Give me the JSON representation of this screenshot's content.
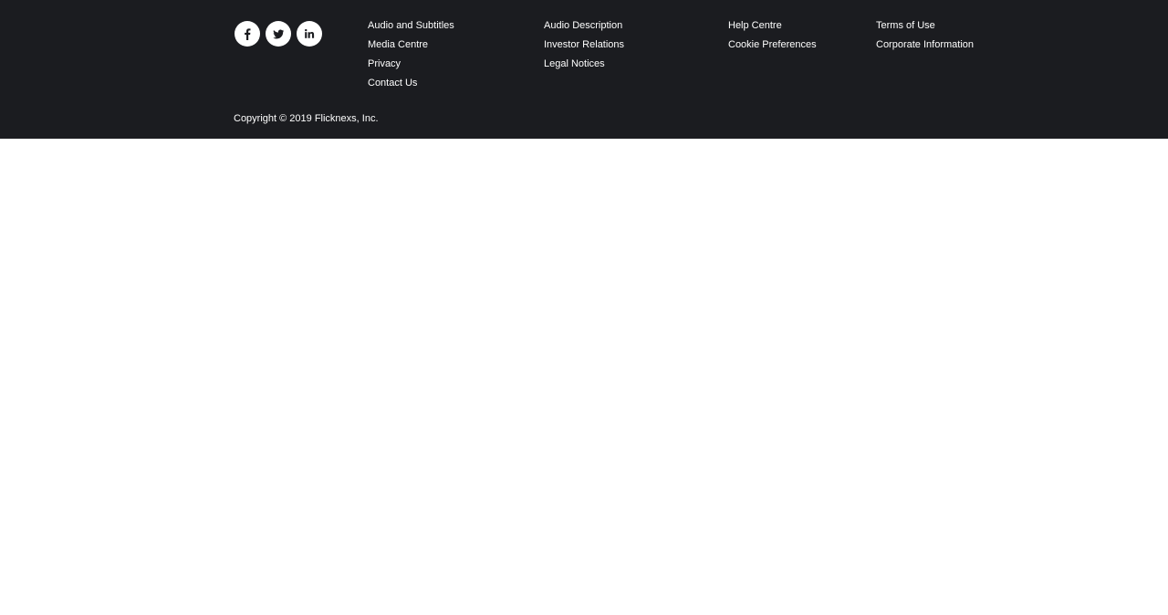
{
  "colors": {
    "footer_background": "#1b1c20",
    "text": "#ffffff",
    "page_background": "#ffffff"
  },
  "social": {
    "icons": [
      "facebook-icon",
      "twitter-icon",
      "linkedin-icon"
    ]
  },
  "links": {
    "col1": [
      "Audio and Subtitles",
      "Media Centre",
      "Privacy",
      "Contact Us"
    ],
    "col2": [
      "Audio Description",
      "Investor Relations",
      "Legal Notices"
    ],
    "col3": [
      "Help Centre",
      "Cookie Preferences"
    ],
    "col4": [
      "Terms of Use",
      "Corporate Information"
    ]
  },
  "copyright": "Copyright © 2019 Flicknexs, Inc."
}
